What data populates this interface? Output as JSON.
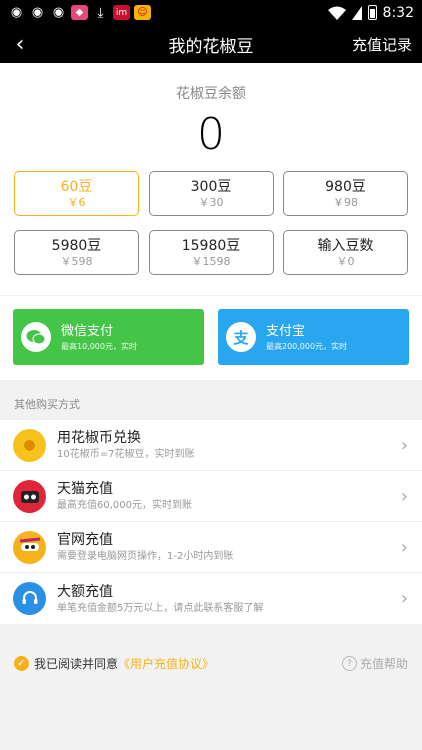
{
  "status_bar": {
    "time": "8:32",
    "icons": [
      "weibo-icon",
      "weibo-icon",
      "weibo-icon",
      "app-icon",
      "download-icon",
      "app-icon",
      "app-icon"
    ],
    "notif_labels": {
      "red": "im"
    }
  },
  "header": {
    "back": "‹",
    "title": "我的花椒豆",
    "right_label": "充值记录"
  },
  "balance": {
    "label": "花椒豆余额",
    "value": "0"
  },
  "packages": [
    {
      "amount": "60豆",
      "price": "￥6"
    },
    {
      "amount": "300豆",
      "price": "￥30"
    },
    {
      "amount": "980豆",
      "price": "￥98"
    },
    {
      "amount": "5980豆",
      "price": "￥598"
    },
    {
      "amount": "15980豆",
      "price": "￥1598"
    },
    {
      "amount": "输入豆数",
      "price": "￥0"
    }
  ],
  "payment": {
    "wechat": {
      "name": "微信支付",
      "note": "最高10,000元，实时"
    },
    "alipay": {
      "name": "支付宝",
      "note": "最高200,000元，实时",
      "icon_char": "支"
    }
  },
  "other": {
    "header": "其他购买方式",
    "methods": [
      {
        "title": "用花椒币兑换",
        "desc": "10花椒币=7花椒豆，实时到账"
      },
      {
        "title": "天猫充值",
        "desc": "最高充值60,000元，实时到账"
      },
      {
        "title": "官网充值",
        "desc": "需要登录电脑网页操作，1-2小时内到账"
      },
      {
        "title": "大额充值",
        "desc": "单笔充值金额5万元以上，请点此联系客服了解"
      }
    ]
  },
  "agreement": {
    "prefix": "我已阅读并同意",
    "link": "《用户充值协议》",
    "help": "充值帮助"
  },
  "colors": {
    "accent": "#f6b21b",
    "wechat": "#44c548",
    "alipay": "#28a6ef"
  }
}
